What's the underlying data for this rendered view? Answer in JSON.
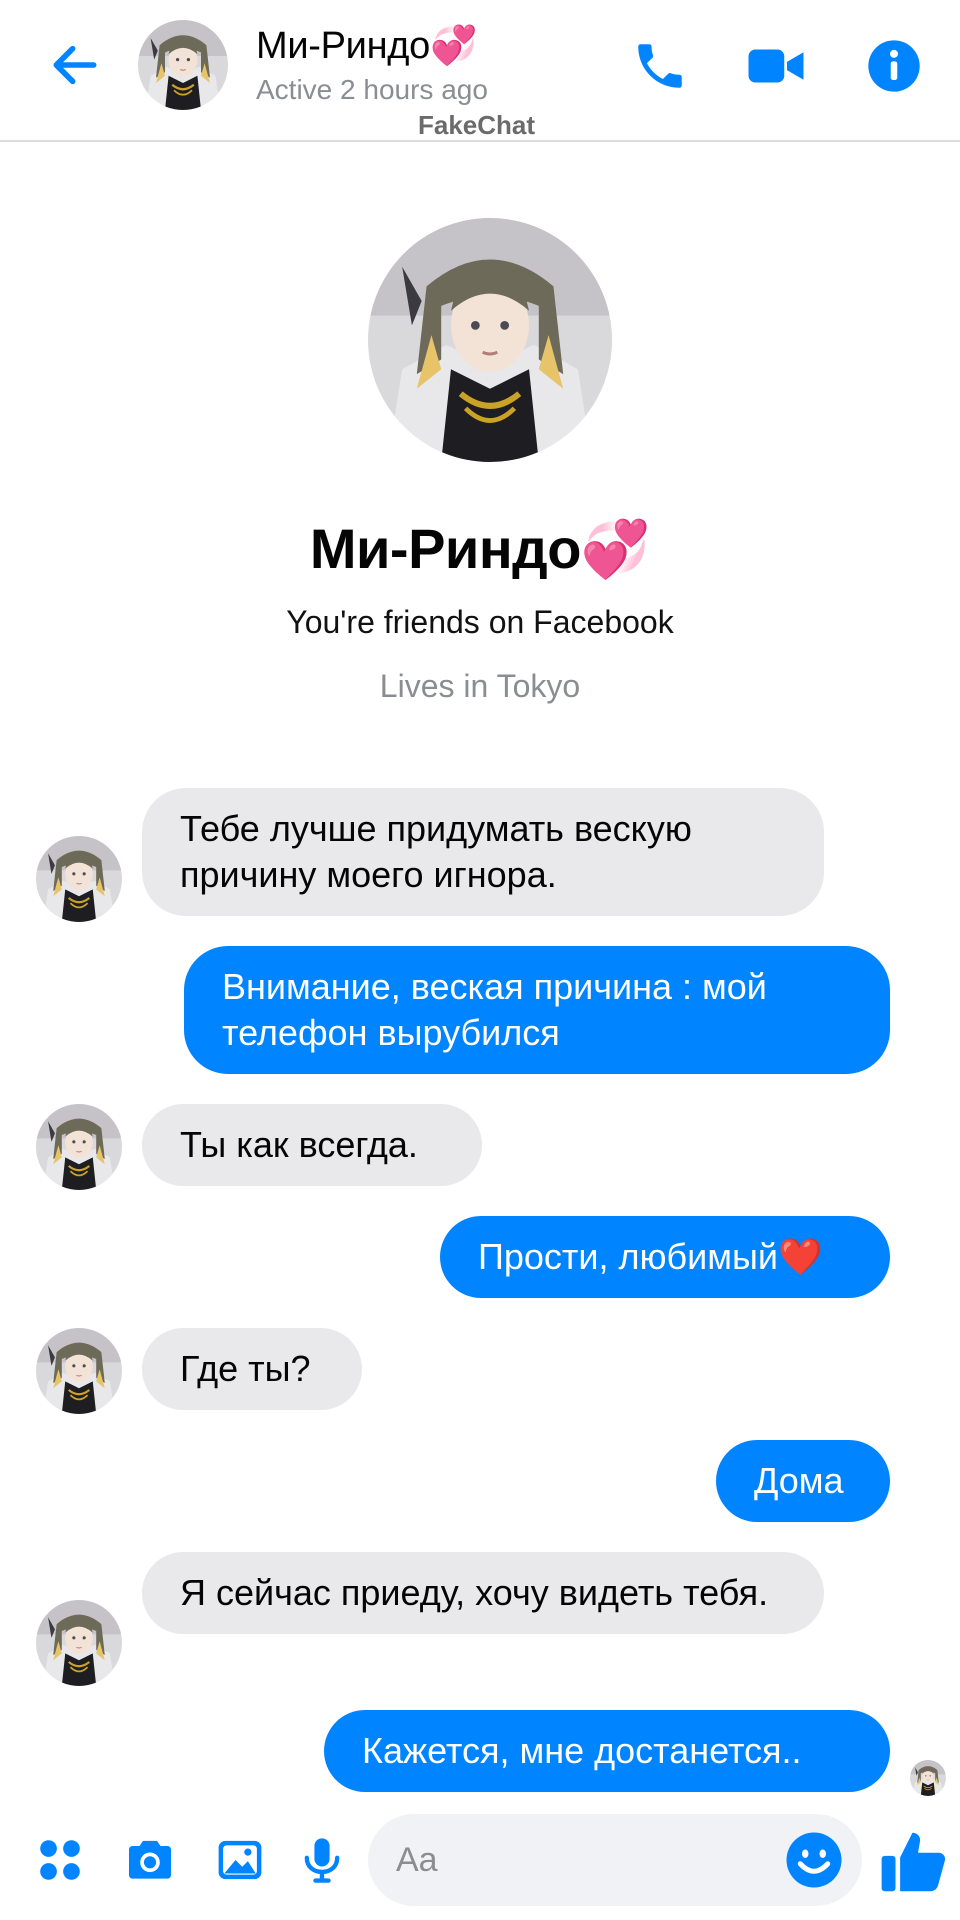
{
  "header": {
    "name": "Ми-Риндо💞",
    "status": "Active 2 hours ago",
    "watermark": "FakeChat"
  },
  "profile": {
    "name": "Ми-Риндо💞",
    "friends_text": "You're friends on Facebook",
    "lives_text": "Lives in Tokyo"
  },
  "messages": [
    {
      "from": "them",
      "text": "Тебе лучше придумать вескую причину моего игнора."
    },
    {
      "from": "me",
      "text": "Внимание, веская причина : мой телефон вырубился"
    },
    {
      "from": "them",
      "text": "Ты как всегда."
    },
    {
      "from": "me",
      "text": "Прости, любимый❤️"
    },
    {
      "from": "them",
      "text": "Где ты?"
    },
    {
      "from": "me",
      "text": "Дома"
    },
    {
      "from": "them",
      "text": "Я сейчас приеду, хочу видеть тебя."
    },
    {
      "from": "me",
      "text": "Кажется, мне достанется.."
    }
  ],
  "composer": {
    "placeholder": "Aa"
  },
  "colors": {
    "accent": "#0084ff",
    "incoming_bubble": "#e9e9eb",
    "status_gray": "#8a8d91"
  },
  "icons": {
    "back": "arrow-left-icon",
    "call": "phone-icon",
    "video": "video-camera-icon",
    "info": "info-icon",
    "apps": "four-dots-icon",
    "camera": "camera-icon",
    "gallery": "image-icon",
    "voice": "microphone-icon",
    "emoji": "smiley-icon",
    "like": "thumbs-up-icon"
  }
}
